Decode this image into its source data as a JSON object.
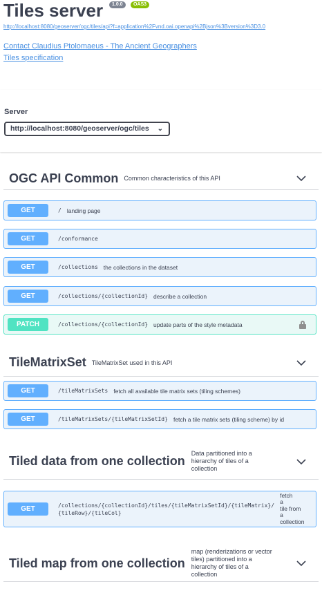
{
  "info": {
    "title": "Tiles server",
    "version_badge": "1.0.0",
    "oas_badge": "OAS3",
    "api_url": "http://localhost:8080/geoserver/ogc/tiles/api?f=application%2Fvnd.oai.openapi%2Bjson%3Bversion%3D3.0",
    "contact": "Contact Claudius Ptolomaeus - The Ancient Geographers",
    "spec": "Tiles specification"
  },
  "servers": {
    "label": "Server",
    "selected": "http://localhost:8080/geoserver/ogc/tiles",
    "chevron": "⌄"
  },
  "tags": [
    {
      "name": "OGC API Common",
      "description": "Common characteristics of this API",
      "operations": [
        {
          "method": "GET",
          "path": "/",
          "summary": "landing page"
        },
        {
          "method": "GET",
          "path": "/conformance",
          "summary": ""
        },
        {
          "method": "GET",
          "path": "/collections",
          "summary": "the collections in the dataset"
        },
        {
          "method": "GET",
          "path": "/collections/{collectionId}",
          "summary": "describe a collection"
        },
        {
          "method": "PATCH",
          "path": "/collections/{collectionId}",
          "summary": "update parts of the style metadata",
          "locked": true
        }
      ]
    },
    {
      "name": "TileMatrixSet",
      "description": "TileMatrixSet used in this API",
      "operations": [
        {
          "method": "GET",
          "path": "/tileMatrixSets",
          "summary": "fetch all available tile matrix sets (tiling schemes)"
        },
        {
          "method": "GET",
          "path": "/tileMatrixSets/{tileMatrixSetId}",
          "summary": "fetch a tile matrix sets (tiling scheme) by id"
        }
      ]
    },
    {
      "name": "Tiled data from one collection",
      "description_lines": [
        "Data partitioned into a",
        "hierarchy of tiles of a",
        "collection"
      ],
      "operations": [
        {
          "method": "GET",
          "path_lines": [
            "/collections/{collectionId}/tiles/{tileMatrixSetId}/{tileMatrix}/",
            "{tileRow}/{tileCol}"
          ],
          "summary_lines": [
            "fetch",
            "a",
            "tile from",
            "a",
            "collection"
          ]
        }
      ]
    },
    {
      "name": "Tiled map from one collection",
      "description_lines": [
        "map (renderizations or vector",
        "tiles) partitioned into a",
        "hierarchy of tiles of a",
        "collection"
      ]
    }
  ],
  "colors": {
    "get": "#61affe",
    "patch": "#50e3c2",
    "link": "#4990e2",
    "text": "#3b4151"
  }
}
